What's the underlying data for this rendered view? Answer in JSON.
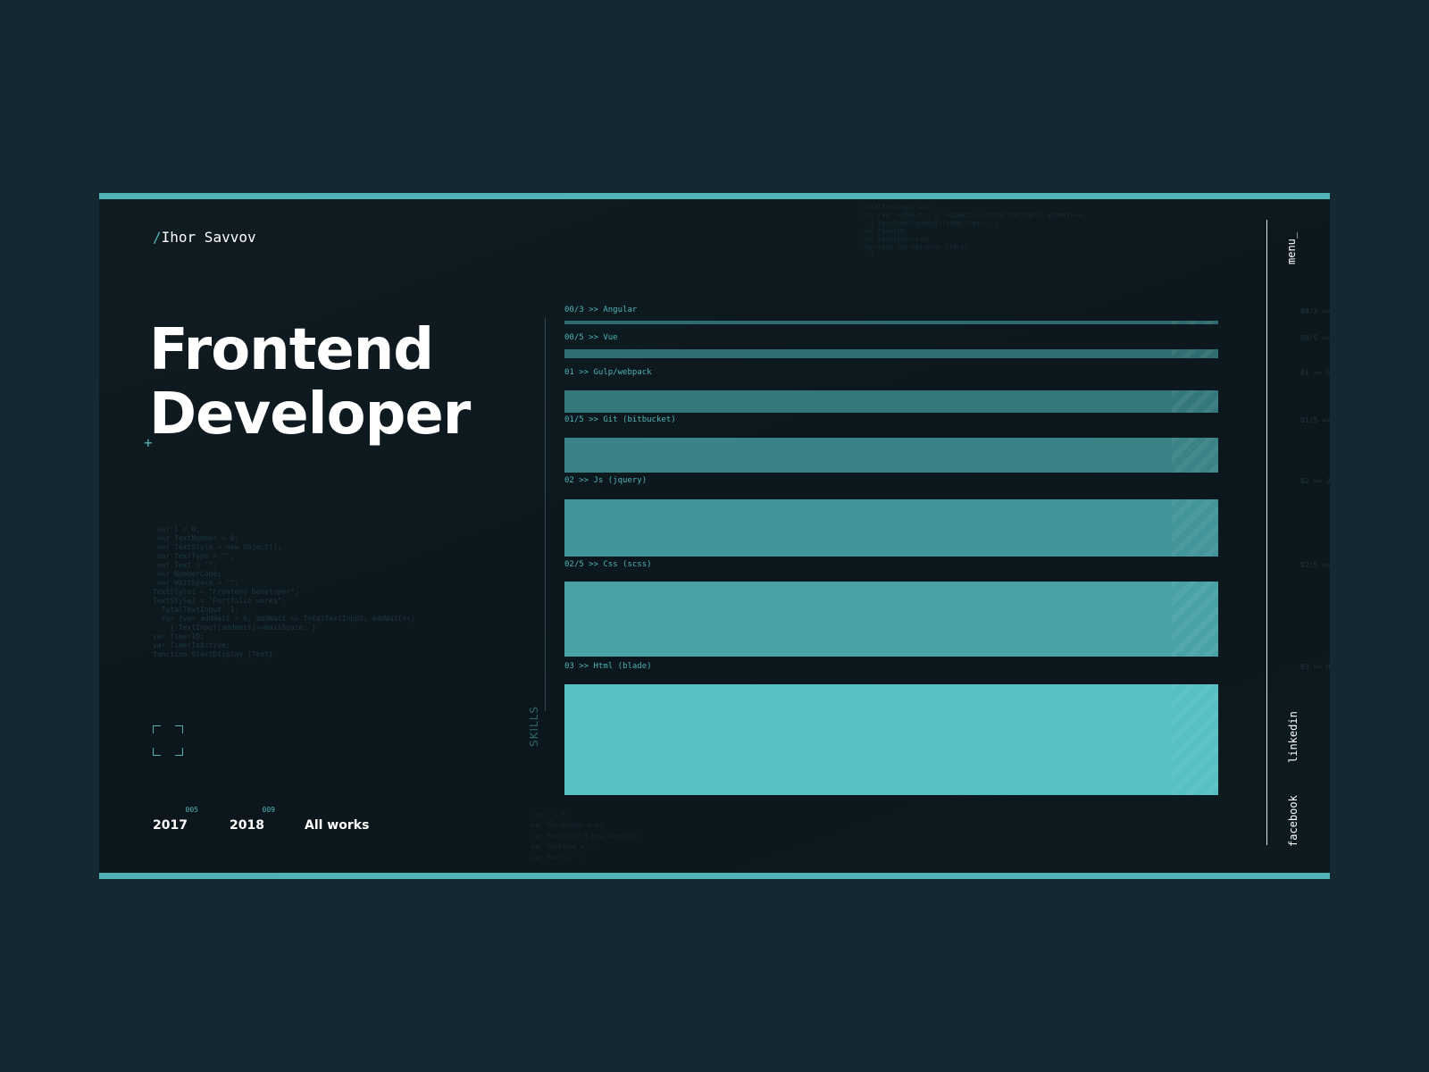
{
  "brand": {
    "slash": "/",
    "name": "Ihor Savvov"
  },
  "hero": {
    "line1": "Frontend",
    "line2": "Developer",
    "plus": "+"
  },
  "code_snippet": " var i = 0;\n var TextNumber = 0;\n var TextStyle = new Object();\n var TextType = \"\";\n var Text = \"\";\n var NumberCode;\n var WaitSpace = \"\";\nTextStyle1 = \"Frontend Developer\";\nTextStyle2 = \"Portfolio works\";\n  TotalTextInput -1;\n  for (var addWait = 0; addWait <= TotalTextInput; addWait++)\n    { TextInput[addWait]+=WaitSpace; }\nvar TimerID;\nvar TimerIsActive;\nfunction StartDisplay (Text)",
  "code_top": "TotalTextInput =1;\nfor (var addWait = 0; addWait <= TotalTextInput; addWait++)\n  { TextInput[addWait]+=WaitSpace; }\nvar TimerID;\nvar TimerIsActive;\nfunction StartDisplay (Text)\n  {",
  "code_bottom": "var i = 0;\nvar TextNumber = 0;\nvar TextStyle = new Object();\nvar TextType = \"\";\nvar Text = \"\";",
  "footer_nav": [
    {
      "label": "2017",
      "count": "005"
    },
    {
      "label": "2018",
      "count": "009"
    },
    {
      "label": "All works",
      "count": ""
    }
  ],
  "skills": {
    "label": "SKILLS",
    "colors": {
      "bar_dark": "#2c6669",
      "bar_light": "#56c0c3"
    },
    "items": [
      {
        "label": "00/3 >> Angular",
        "level": 0.05
      },
      {
        "label": "00/5 >> Vue",
        "level": 0.09
      },
      {
        "label": "01 >> Gulp/webpack",
        "level": 0.2
      },
      {
        "label": "01/5 >> Git (bitbucket)",
        "level": 0.32
      },
      {
        "label": "02 >> Js (jquery)",
        "level": 0.52
      },
      {
        "label": "02/5 >> Css (scss)",
        "level": 0.68
      },
      {
        "label": "03 >> Html (blade)",
        "level": 1.0
      }
    ]
  },
  "side": {
    "menu": "menu_",
    "linkedin": "linkedin",
    "facebook": "facebook"
  },
  "ghost_labels": [
    "00/3 >>",
    "00/5 >>",
    "01 >> Gu",
    "01/5 >>",
    "02 >> Js",
    "02/5 >>",
    "03 >> Ht"
  ],
  "accent": "#4fb3b6"
}
